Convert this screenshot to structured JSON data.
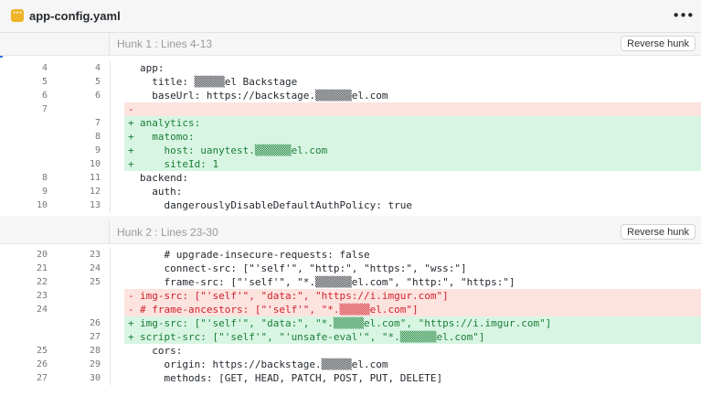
{
  "file": {
    "name": "app-config.yaml",
    "icon": "yaml-file-icon",
    "icon_glyph": "···",
    "more_glyph": "•••",
    "accent_color": "#f0b429"
  },
  "hunks": [
    {
      "title": "Hunk 1 : Lines 4-13",
      "reverse_label": "Reverse hunk",
      "lines": [
        {
          "type": "ctx",
          "old": "4",
          "new": "4",
          "marker": "",
          "text": "app:"
        },
        {
          "type": "ctx",
          "old": "5",
          "new": "5",
          "marker": "",
          "text": "  title: ▒▒▒▒▒el Backstage"
        },
        {
          "type": "ctx",
          "old": "6",
          "new": "6",
          "marker": "",
          "text": "  baseUrl: https://backstage.▒▒▒▒▒▒el.com"
        },
        {
          "type": "del",
          "old": "7",
          "new": "",
          "marker": "-",
          "text": ""
        },
        {
          "type": "add",
          "old": "",
          "new": "7",
          "marker": "+",
          "text": "analytics:"
        },
        {
          "type": "add",
          "old": "",
          "new": "8",
          "marker": "+",
          "text": "  matomo:"
        },
        {
          "type": "add",
          "old": "",
          "new": "9",
          "marker": "+",
          "text": "    host: uanytest.▒▒▒▒▒▒el.com"
        },
        {
          "type": "add",
          "old": "",
          "new": "10",
          "marker": "+",
          "text": "    siteId: 1"
        },
        {
          "type": "ctx",
          "old": "8",
          "new": "11",
          "marker": "",
          "text": "backend:"
        },
        {
          "type": "ctx",
          "old": "9",
          "new": "12",
          "marker": "",
          "text": "  auth:"
        },
        {
          "type": "ctx",
          "old": "10",
          "new": "13",
          "marker": "",
          "text": "    dangerouslyDisableDefaultAuthPolicy: true"
        }
      ]
    },
    {
      "title": "Hunk 2 : Lines 23-30",
      "reverse_label": "Reverse hunk",
      "lines": [
        {
          "type": "ctx",
          "old": "20",
          "new": "23",
          "marker": "",
          "text": "    # upgrade-insecure-requests: false"
        },
        {
          "type": "ctx",
          "old": "21",
          "new": "24",
          "marker": "",
          "text": "    connect-src: [\"'self'\", \"http:\", \"https:\", \"wss:\"]"
        },
        {
          "type": "ctx",
          "old": "22",
          "new": "25",
          "marker": "",
          "text": "    frame-src: [\"'self'\", \"*.▒▒▒▒▒▒el.com\", \"http:\", \"https:\"]"
        },
        {
          "type": "del",
          "old": "23",
          "new": "",
          "marker": "-",
          "text": "img-src: [\"'self'\", \"data:\", \"https://i.imgur.com\"]"
        },
        {
          "type": "del",
          "old": "24",
          "new": "",
          "marker": "-",
          "text": "# frame-ancestors: [\"'self'\", \"*.▒▒▒▒▒el.com\"]"
        },
        {
          "type": "add",
          "old": "",
          "new": "26",
          "marker": "+",
          "text": "img-src: [\"'self'\", \"data:\", \"*.▒▒▒▒▒el.com\", \"https://i.imgur.com\"]"
        },
        {
          "type": "add",
          "old": "",
          "new": "27",
          "marker": "+",
          "text": "script-src: [\"'self'\", \"'unsafe-eval'\", \"*.▒▒▒▒▒▒el.com\"]"
        },
        {
          "type": "ctx",
          "old": "25",
          "new": "28",
          "marker": "",
          "text": "  cors:"
        },
        {
          "type": "ctx",
          "old": "26",
          "new": "29",
          "marker": "",
          "text": "    origin: https://backstage.▒▒▒▒▒el.com"
        },
        {
          "type": "ctx",
          "old": "27",
          "new": "30",
          "marker": "",
          "text": "    methods: [GET, HEAD, PATCH, POST, PUT, DELETE]"
        }
      ]
    }
  ]
}
